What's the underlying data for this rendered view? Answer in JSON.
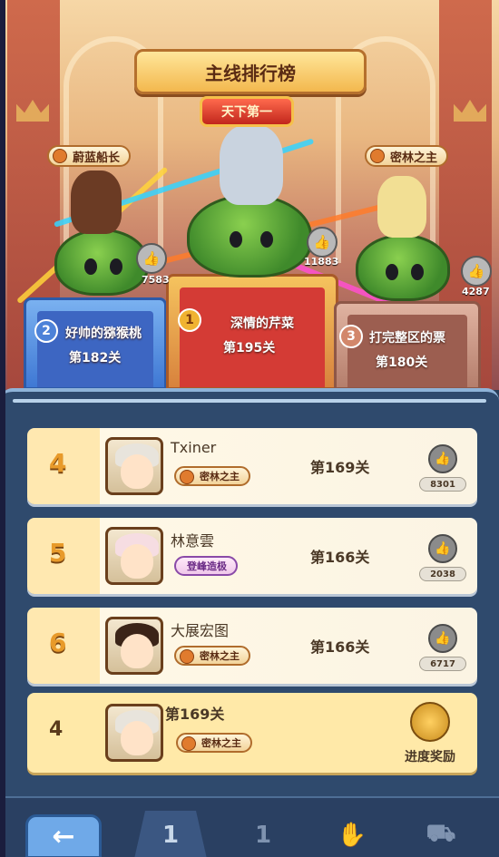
{
  "title": "主线排行榜",
  "champion_tag": "天下第一",
  "podium": [
    {
      "rank": "2",
      "name": "好帅的猕猴桃",
      "level": "第182关",
      "title": "蔚蓝船长",
      "likes": "7583"
    },
    {
      "rank": "1",
      "name": "深情的芹菜",
      "level": "第195关",
      "title": "",
      "likes": "11883"
    },
    {
      "rank": "3",
      "name": "打完整区的票",
      "level": "第180关",
      "title": "密林之主",
      "likes": "4287"
    }
  ],
  "rows": [
    {
      "rank": "4",
      "name": "Txiner",
      "title": "密林之主",
      "level": "第169关",
      "likes": "8301"
    },
    {
      "rank": "5",
      "name": "林意雲",
      "title": "登峰造极",
      "level": "第166关",
      "likes": "2038"
    },
    {
      "rank": "6",
      "name": "大展宏图",
      "title": "密林之主",
      "level": "第166关",
      "likes": "6717"
    }
  ],
  "me": {
    "rank": "4",
    "level": "第169关",
    "title": "密林之主",
    "reward_label": "进度奖励"
  },
  "nav": {
    "back_glyph": "←",
    "tabs": [
      {
        "glyph": "1"
      },
      {
        "glyph": "1"
      },
      {
        "glyph": "✋"
      },
      {
        "glyph": "⛟"
      }
    ]
  },
  "colors": {
    "podium_gold": "#d43b35",
    "podium_silver": "#3d66c2",
    "podium_bronze": "#9c5e50",
    "panel": "#2f4a6d"
  },
  "icons": [
    "crown-icon",
    "thumbs-up-icon",
    "medal-icon",
    "treasure-chest-icon",
    "back-arrow-icon",
    "trophy-icon",
    "handshake-icon",
    "cart-icon"
  ]
}
